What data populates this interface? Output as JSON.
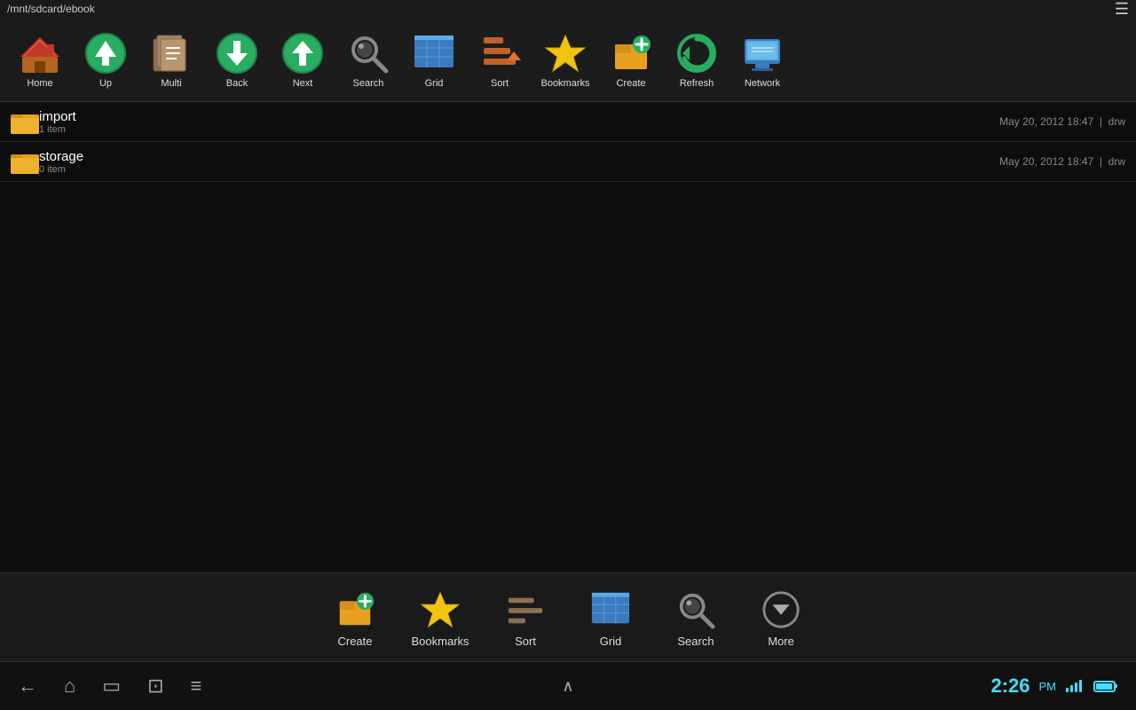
{
  "titlebar": {
    "path": "/mnt/sdcard/ebook",
    "menu_icon": "≡"
  },
  "toolbar": {
    "buttons": [
      {
        "label": "Home",
        "icon": "home"
      },
      {
        "label": "Up",
        "icon": "up"
      },
      {
        "label": "Multi",
        "icon": "multi"
      },
      {
        "label": "Back",
        "icon": "back"
      },
      {
        "label": "Next",
        "icon": "next"
      },
      {
        "label": "Search",
        "icon": "search"
      },
      {
        "label": "Grid",
        "icon": "grid"
      },
      {
        "label": "Sort",
        "icon": "sort"
      },
      {
        "label": "Bookmarks",
        "icon": "bookmarks"
      },
      {
        "label": "Create",
        "icon": "create"
      },
      {
        "label": "Refresh",
        "icon": "refresh"
      },
      {
        "label": "Network",
        "icon": "network"
      }
    ]
  },
  "files": [
    {
      "name": "import",
      "count": "1 item",
      "date": "May 20, 2012 18:47",
      "perms": "drw"
    },
    {
      "name": "storage",
      "count": "0 item",
      "date": "May 20, 2012 18:47",
      "perms": "drw"
    }
  ],
  "bottom_bar": {
    "buttons": [
      {
        "label": "Create",
        "icon": "create"
      },
      {
        "label": "Bookmarks",
        "icon": "bookmarks"
      },
      {
        "label": "Sort",
        "icon": "sort"
      },
      {
        "label": "Grid",
        "icon": "grid"
      },
      {
        "label": "Search",
        "icon": "search"
      },
      {
        "label": "More",
        "icon": "more"
      }
    ]
  },
  "navbar": {
    "back_label": "←",
    "home_label": "⌂",
    "recent_label": "▭",
    "screenshot_label": "⊡",
    "menu_label": "≡",
    "up_label": "∧",
    "time": "2:26",
    "ampm": "PM"
  }
}
